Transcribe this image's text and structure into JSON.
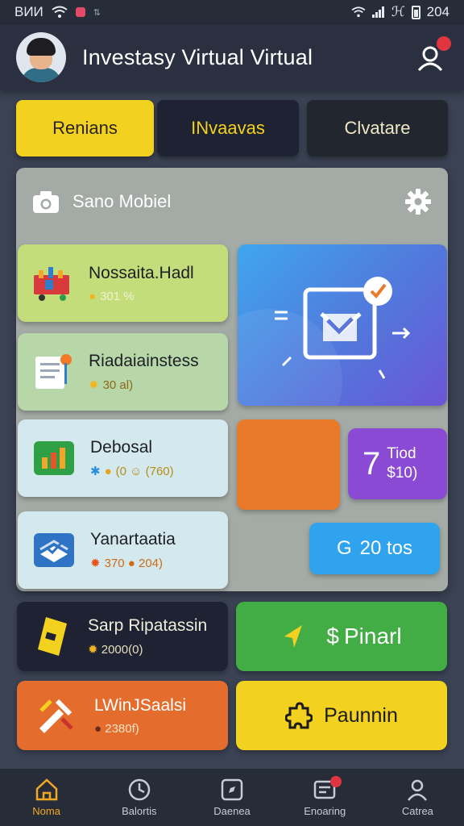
{
  "status_bar": {
    "time": "ВИИ",
    "right_text": "204",
    "network": "ℋ"
  },
  "header": {
    "title": "Investasy Virtual Virtual"
  },
  "tabs": [
    {
      "label": "Renians"
    },
    {
      "label": "INvaavas"
    },
    {
      "label": "Clvatare"
    }
  ],
  "panel": {
    "title": "Sano Mobiel"
  },
  "list_cards": [
    {
      "name": "Nossaita.Hadl",
      "meta": "301 %"
    },
    {
      "name": "Riadaiainstess",
      "meta": "30 al)"
    },
    {
      "name": "Debosal",
      "meta": "(0 ☺ (760)"
    },
    {
      "name": "Yanartaatia",
      "meta": "370 ● 204)"
    }
  ],
  "purple_card": {
    "big": "7",
    "line1": "Tiod",
    "line2": "$10)"
  },
  "blue_card": {
    "icon_text": "G",
    "label": "20 tos"
  },
  "bottom_cards": [
    {
      "name": "Sarp Ripatassin",
      "meta": "2000(0)"
    },
    {
      "name": "Pinarl"
    },
    {
      "name": "LWinJSaalsi",
      "meta": "2380f)"
    },
    {
      "name": "Paunnin"
    }
  ],
  "nav": [
    {
      "label": "Noma"
    },
    {
      "label": "Balortis"
    },
    {
      "label": "Daenea"
    },
    {
      "label": "Enoaring"
    },
    {
      "label": "Catrea"
    }
  ],
  "colors": {
    "accent_yellow": "#f3d21f",
    "dark_card": "#1e2232",
    "green": "#43ad45",
    "orange": "#e46d2e",
    "purple": "#8a4ad4",
    "blue": "#2fa3ee"
  }
}
